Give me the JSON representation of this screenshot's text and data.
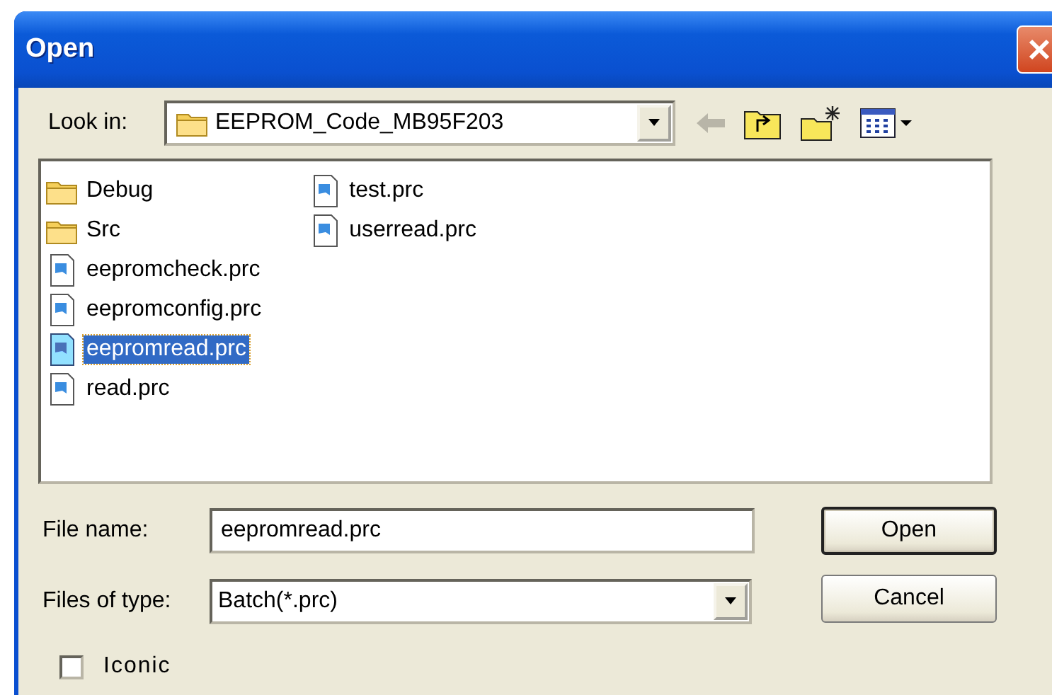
{
  "window": {
    "title": "Open"
  },
  "look_in": {
    "label": "Look in:",
    "value": "EEPROM_Code_MB95F203"
  },
  "files": [
    {
      "name": "Debug",
      "kind": "folder",
      "selected": false
    },
    {
      "name": "Src",
      "kind": "folder",
      "selected": false
    },
    {
      "name": "eepromcheck.prc",
      "kind": "file",
      "selected": false
    },
    {
      "name": "eepromconfig.prc",
      "kind": "file",
      "selected": false
    },
    {
      "name": "eepromread.prc",
      "kind": "file",
      "selected": true
    },
    {
      "name": "read.prc",
      "kind": "file",
      "selected": false
    },
    {
      "name": "test.prc",
      "kind": "file",
      "selected": false
    },
    {
      "name": "userread.prc",
      "kind": "file",
      "selected": false
    }
  ],
  "file_name": {
    "label": "File name:",
    "value": "eepromread.prc"
  },
  "file_type": {
    "label": "Files of type:",
    "value": "Batch(*.prc)"
  },
  "buttons": [
    {
      "label": "Open",
      "default": true
    },
    {
      "label": "Cancel",
      "default": false
    }
  ],
  "iconic": {
    "label": "Iconic",
    "checked": false
  }
}
